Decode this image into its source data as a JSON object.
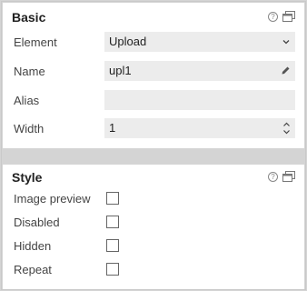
{
  "basic": {
    "title": "Basic",
    "fields": {
      "element": {
        "label": "Element",
        "value": "Upload"
      },
      "name": {
        "label": "Name",
        "value": "upl1"
      },
      "alias": {
        "label": "Alias",
        "value": ""
      },
      "width": {
        "label": "Width",
        "value": "1"
      }
    }
  },
  "style": {
    "title": "Style",
    "options": {
      "image_preview": {
        "label": "Image preview",
        "checked": false
      },
      "disabled": {
        "label": "Disabled",
        "checked": false
      },
      "hidden": {
        "label": "Hidden",
        "checked": false
      },
      "repeat": {
        "label": "Repeat",
        "checked": false
      }
    }
  },
  "icons": {
    "help": "?",
    "help_icon": "help-icon",
    "window_icon": "popout-window-icon",
    "dropdown_icon": "chevron-down-icon",
    "edit_icon": "pencil-icon",
    "stepper_icon": "stepper-icon"
  }
}
